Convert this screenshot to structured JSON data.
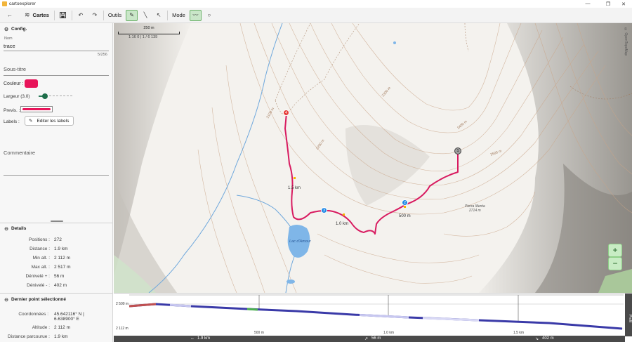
{
  "window": {
    "title": "cartoexplorer",
    "min": "—",
    "max": "❐",
    "close": "✕"
  },
  "toolbar": {
    "cartes_label": "Cartes",
    "outils_label": "Outils",
    "mode_label": "Mode",
    "icons": {
      "back": "←",
      "layers": "≋",
      "save": "💾",
      "undo": "↶",
      "redo": "↷",
      "draw": "✎",
      "line": "╲",
      "pointer": "↖",
      "trace": "〰",
      "circle": "○"
    }
  },
  "config": {
    "header": "Config.",
    "nom_label": "Nom",
    "nom_value": "trace",
    "char_count": "5/256",
    "subtitle_placeholder": "Sous-titre",
    "couleur_label": "Couleur :",
    "color": "#e8145a",
    "largeur_label": "Largeur (3.0)",
    "previs_label": "Previs. :",
    "labels_label": "Labels :",
    "edit_labels_button": "Editer les labels",
    "comment_placeholder": "Commentaire"
  },
  "details": {
    "header": "Details",
    "rows": [
      {
        "k": "Positions :",
        "v": "272"
      },
      {
        "k": "Distance :",
        "v": "1.9 km"
      },
      {
        "k": "Min alt. :",
        "v": "2 112 m"
      },
      {
        "k": "Max alt. :",
        "v": "2 517 m"
      },
      {
        "k": "Dénivelé + :",
        "v": "56 m"
      },
      {
        "k": "Dénivelé - :",
        "v": "402 m"
      }
    ]
  },
  "selected_point": {
    "header": "Dernier point sélectionné",
    "coord_label": "Coordonnées :",
    "coord_value_1": "45.642116° N  |",
    "coord_value_2": "6.638900° E",
    "altitude_label": "Altitude :",
    "altitude_value": "2 112 m",
    "distance_label": "Distance parcourue :",
    "distance_value": "1.9 km"
  },
  "map": {
    "scale_label": "250 m",
    "scale_ratio": "1:16 0 | 1 / 6 139",
    "attribution": "© OpenTopoMap",
    "lake_label": "Lac d'Amour",
    "peak_label": "Pierra Menta",
    "peak_alt": "2714 m",
    "dist_labels": [
      "1.5 km",
      "1.0 km",
      "500 m"
    ],
    "waypoints": [
      "1",
      "2",
      "3",
      "4"
    ],
    "contour_labels": [
      "2200 m",
      "2300 m",
      "2400 m",
      "2500 m",
      "2100 m"
    ],
    "zoom_in": "+",
    "zoom_out": "−",
    "route_color": "#d81b60"
  },
  "profile": {
    "y_labels": [
      "2 500 m",
      "2 112 m"
    ],
    "x_labels": [
      "500 m",
      "1.0 km",
      "1.5 km"
    ],
    "toggle_label": "Profil"
  },
  "status": {
    "distance": "1.9 km",
    "up": "56 m",
    "down": "402 m"
  }
}
